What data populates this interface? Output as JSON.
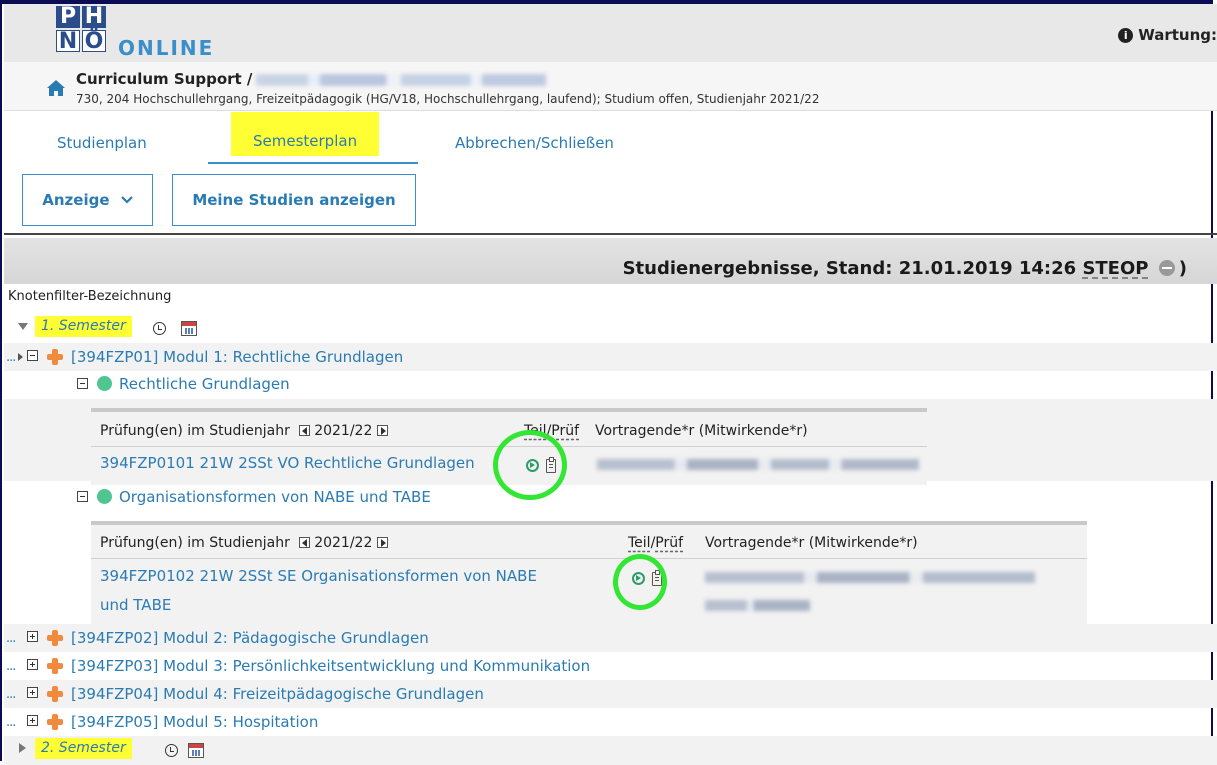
{
  "logo": {
    "letters": [
      "P",
      "H",
      "N",
      "Ö"
    ],
    "brand": "ONLINE",
    "colors": {
      "dark": "#2b4d8c",
      "light": "#ffffff",
      "accent": "#3a8fc9"
    }
  },
  "header": {
    "maintenance": "Wartung:"
  },
  "breadcrumb": {
    "title": "Curriculum Support /",
    "subtitle": "730, 204 Hochschullehrgang, Freizeitpädagogik (HG/V18, Hochschullehrgang, laufend); Studium offen, Studienjahr 2021/22"
  },
  "tabs": [
    {
      "label": "Studienplan"
    },
    {
      "label": "Semesterplan"
    },
    {
      "label": "Abbrechen/Schließen"
    }
  ],
  "toolbar": {
    "display_label": "Anzeige",
    "my_studies_label": "Meine Studien anzeigen"
  },
  "results": {
    "title": "Studienergebnisse, Stand: 21.01.2019 14:26",
    "steop": "STEOP",
    "close_paren": ")",
    "filter_label": "Knotenfilter-Bezeichnung"
  },
  "tree": {
    "semester1": "1. Semester",
    "semester2": "2. Semester",
    "dots": "...",
    "modules": [
      "[394FZP01] Modul 1: Rechtliche Grundlagen",
      "[394FZP02] Modul 2: Pädagogische Grundlagen",
      "[394FZP03] Modul 3: Persönlichkeitsentwicklung und Kommunikation",
      "[394FZP04] Modul 4: Freizeitpädagogische Grundlagen",
      "[394FZP05] Modul 5: Hospitation"
    ],
    "courses": [
      "Rechtliche Grundlagen",
      "Organisationsformen von NABE und TABE"
    ]
  },
  "exams": {
    "header_label": "Prüfung(en) im Studienjahr",
    "year": "2021/22",
    "teil": "Teil",
    "slash": "/",
    "pruef": "Prüf",
    "lecturers": "Vortragende*r (Mitwirkende*r)",
    "exam1": "394FZP0101 21W 2SSt VO Rechtliche Grundlagen",
    "exam2_line1": "394FZP0102 21W 2SSt SE Organisationsformen von NABE",
    "exam2_line2": "und TABE"
  },
  "colors": {
    "highlight": "#ffff33",
    "link": "#2b7bb3",
    "circle": "#33e633",
    "module_icon": "#f08a3c",
    "course_icon": "#4fc58f"
  }
}
